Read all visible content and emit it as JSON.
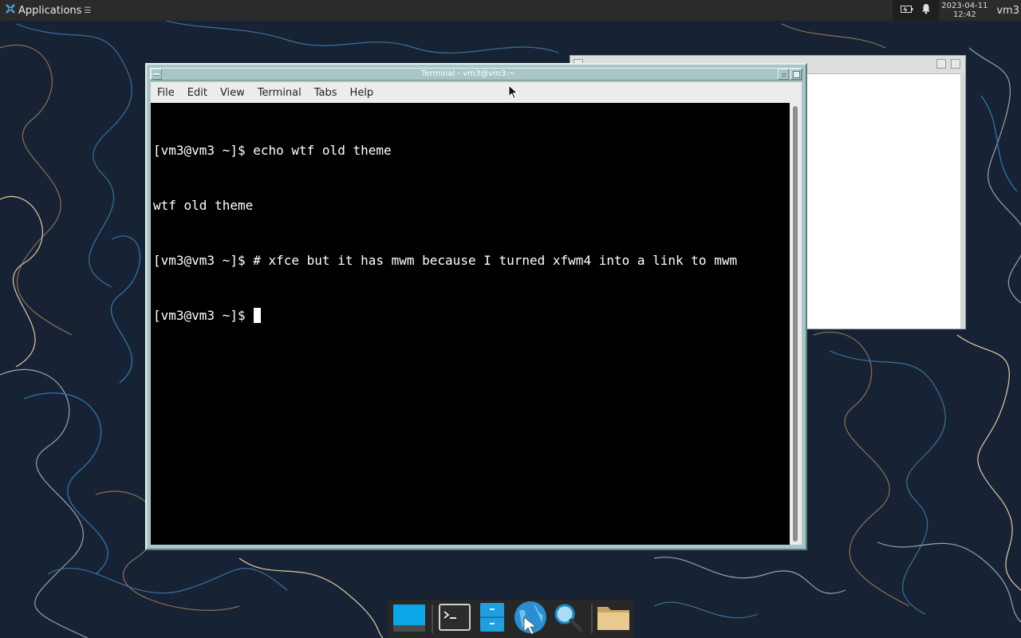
{
  "top_panel": {
    "apps_menu_label": "Applications",
    "clock": {
      "date": "2023-04-11",
      "time": "12:42"
    },
    "username": "vm3",
    "icons": [
      "xfce-logo-icon",
      "menu-glyph-icon",
      "battery-icon",
      "bell-icon"
    ]
  },
  "terminal": {
    "title": "Terminal - vm3@vm3:~",
    "menu": [
      "File",
      "Edit",
      "View",
      "Terminal",
      "Tabs",
      "Help"
    ],
    "lines": [
      "[vm3@vm3 ~]$ echo wtf old theme",
      "wtf old theme",
      "[vm3@vm3 ~]$ # xfce but it has mwm because I turned xfwm4 into a link to mwm",
      "[vm3@vm3 ~]$ "
    ]
  },
  "dock": {
    "items": [
      {
        "name": "show-desktop",
        "icon": "desktop-icon"
      },
      {
        "name": "terminal",
        "icon": "terminal-icon"
      },
      {
        "name": "file-manager",
        "icon": "file-cabinet-icon"
      },
      {
        "name": "web-browser",
        "icon": "globe-icon"
      },
      {
        "name": "app-finder",
        "icon": "magnifier-icon"
      },
      {
        "name": "folder",
        "icon": "folder-icon"
      }
    ]
  },
  "colors": {
    "panel": "#2b2b2b",
    "terminal_bg": "#000000",
    "mwm_frame": "#a9c6c6",
    "accent_blue": "#00a6e0"
  }
}
